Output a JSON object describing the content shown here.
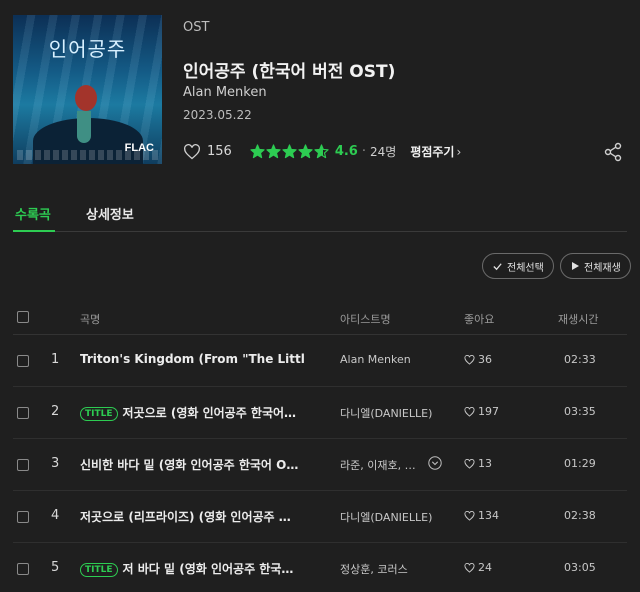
{
  "album": {
    "cover_title": "인어공주",
    "cover_badge": "FLAC",
    "category": "OST",
    "title": "인어공주 (한국어 버전 OST)",
    "artist": "Alan Menken",
    "release_date": "2023.05.22",
    "likes": "156",
    "rating_value": 4.6,
    "rating": "4.6",
    "rating_sep": "·",
    "rating_count": "24명",
    "review_link": "평점주기",
    "review_chevron": "›",
    "share_icon": "share-icon"
  },
  "tabs": [
    {
      "label": "수록곡",
      "active": true
    },
    {
      "label": "상세정보",
      "active": false
    }
  ],
  "actions": {
    "select_all": "전체선택",
    "play_all": "전체재생"
  },
  "table": {
    "headers": {
      "title": "곡명",
      "artist": "아티스트명",
      "likes": "좋아요",
      "duration": "재생시간"
    },
    "rows": [
      {
        "num": "1",
        "badge": "",
        "title": "Triton's Kingdom (From \"The Little…",
        "artist": "Alan Menken",
        "more": false,
        "likes": "36",
        "duration": "02:33"
      },
      {
        "num": "2",
        "badge": "TITLE",
        "title": "저곳으로 (영화 인어공주 한국어…",
        "artist": "다니엘(DANIELLE)",
        "more": false,
        "likes": "197",
        "duration": "03:35"
      },
      {
        "num": "3",
        "badge": "",
        "title": "신비한 바다 밑 (영화 인어공주 한국어 O…",
        "artist": "라준, 이재호, …",
        "more": true,
        "likes": "13",
        "duration": "01:29"
      },
      {
        "num": "4",
        "badge": "",
        "title": "저곳으로 (리프라이즈) (영화 인어공주 …",
        "artist": "다니엘(DANIELLE)",
        "more": false,
        "likes": "134",
        "duration": "02:38"
      },
      {
        "num": "5",
        "badge": "TITLE",
        "title": "저 바다 밑 (영화 인어공주 한국…",
        "artist": "정상훈, 코러스",
        "more": false,
        "likes": "24",
        "duration": "03:05"
      }
    ]
  },
  "colors": {
    "accent": "#2dcc52",
    "background": "#1f1f1f",
    "text": "#e8e8e8"
  }
}
